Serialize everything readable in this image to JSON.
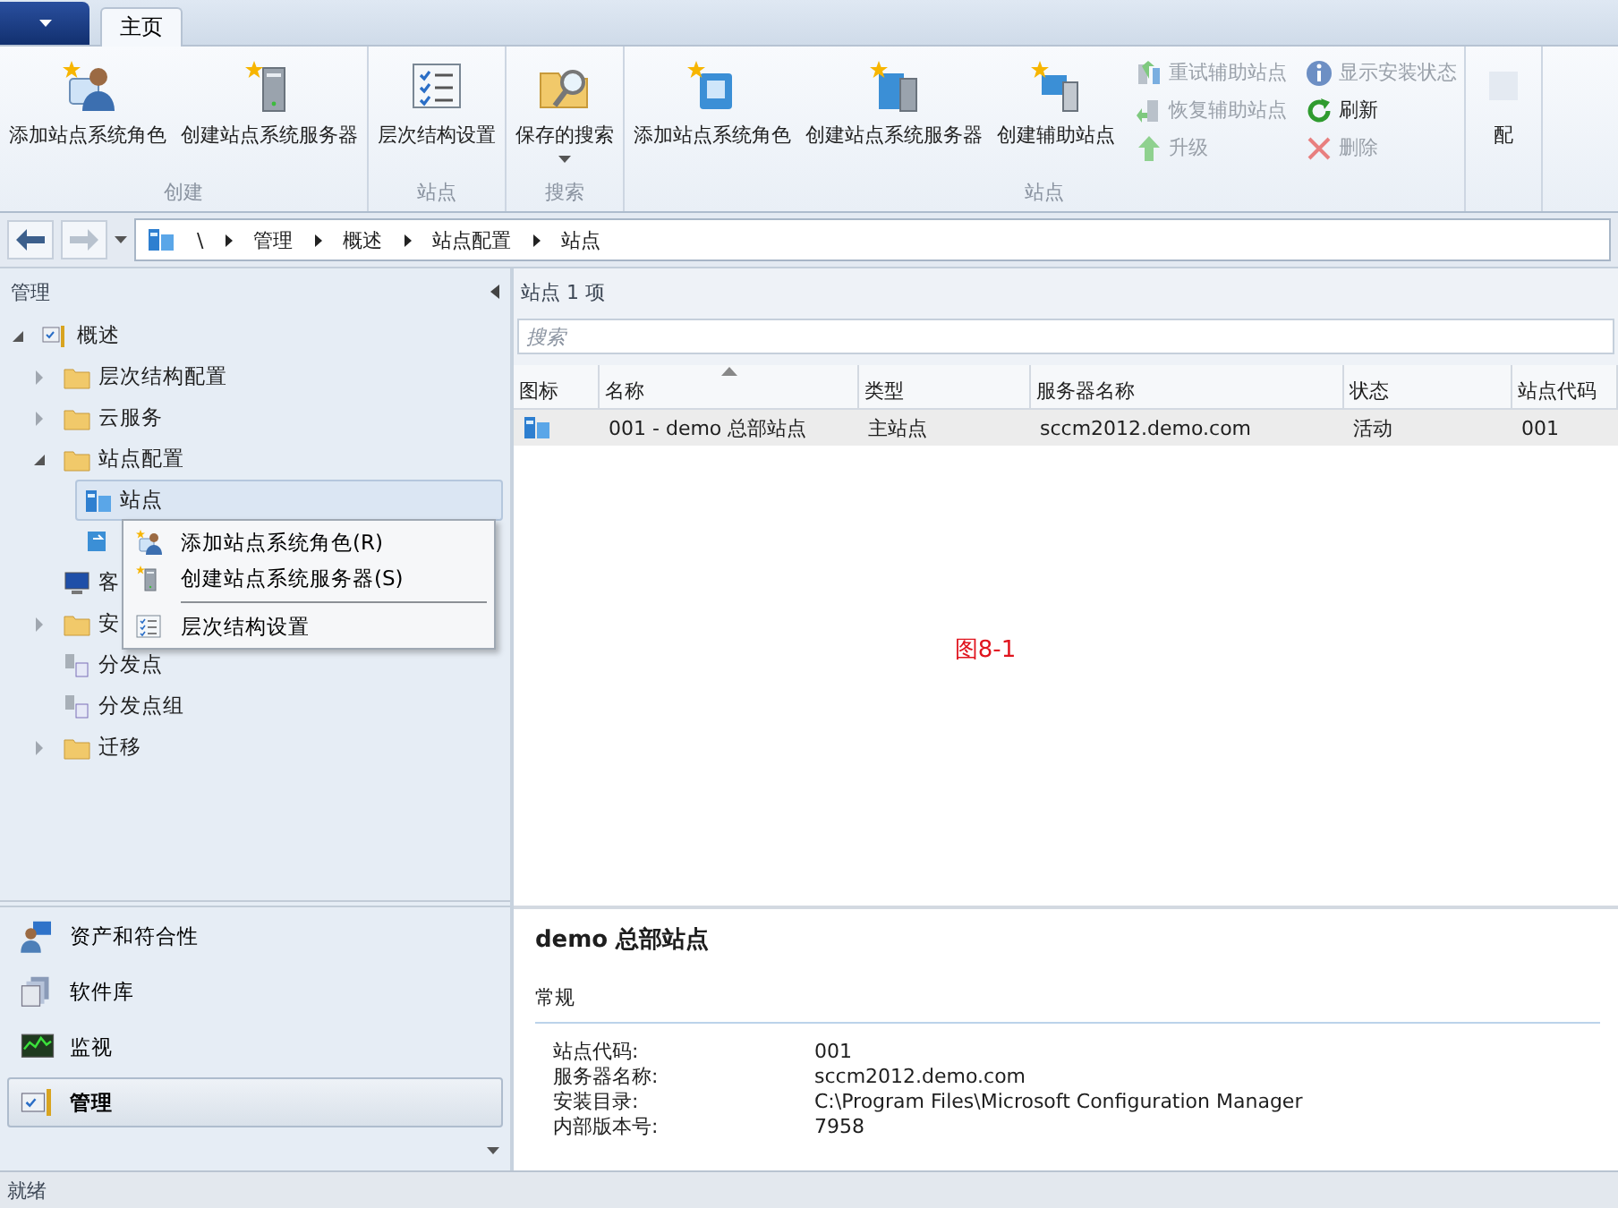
{
  "tabs": [
    {
      "label": "主页",
      "selected": true
    }
  ],
  "ribbon": {
    "groups": [
      {
        "label": "创建",
        "large": [
          {
            "label": "添加站点系统角色",
            "dropdown": false
          },
          {
            "label": "创建站点系统服务器",
            "dropdown": false
          }
        ]
      },
      {
        "label": "站点",
        "large": [
          {
            "label": "层次结构设置",
            "dropdown": false
          }
        ]
      },
      {
        "label": "搜索",
        "large": [
          {
            "label": "保存的搜索",
            "dropdown": true
          }
        ]
      },
      {
        "label": "站点",
        "large": [
          {
            "label": "添加站点系统角色",
            "dropdown": false
          },
          {
            "label": "创建站点系统服务器",
            "dropdown": false
          },
          {
            "label": "创建辅助站点",
            "dropdown": false
          }
        ],
        "small": [
          {
            "label": "重试辅助站点",
            "disabled": true
          },
          {
            "label": "恢复辅助站点",
            "disabled": true
          },
          {
            "label": "升级",
            "disabled": true
          },
          {
            "label": "显示安装状态",
            "disabled": true
          },
          {
            "label": "刷新",
            "disabled": false
          },
          {
            "label": "删除",
            "disabled": true
          }
        ]
      },
      {
        "large": [
          {
            "label": "配",
            "dropdown": false
          }
        ]
      }
    ]
  },
  "address_bar": {
    "path": [
      "\\",
      "管理",
      "概述",
      "站点配置",
      "站点"
    ]
  },
  "navigation": {
    "title": "管理",
    "tree": [
      {
        "label": "概述",
        "expanded": true,
        "selected": false,
        "children": [
          {
            "label": "层次结构配置",
            "expanded": false,
            "selected": false
          },
          {
            "label": "云服务",
            "expanded": false,
            "selected": false
          },
          {
            "label": "站点配置",
            "expanded": true,
            "selected": false,
            "children": [
              {
                "label": "站点",
                "selected": true
              },
              {
                "selected": false
              }
            ]
          },
          {
            "label": "客",
            "selected": false
          },
          {
            "label": "安",
            "expanded": false,
            "selected": false
          },
          {
            "label": "分发点",
            "selected": false
          },
          {
            "label": "分发点组",
            "selected": false
          },
          {
            "label": "迁移",
            "expanded": false,
            "selected": false
          }
        ]
      }
    ],
    "sections": [
      {
        "label": "资产和符合性",
        "selected": false
      },
      {
        "label": "软件库",
        "selected": false
      },
      {
        "label": "监视",
        "selected": false
      },
      {
        "label": "管理",
        "selected": true
      }
    ]
  },
  "context_menu": {
    "items": [
      {
        "kind": "command",
        "label": "添加站点系统角色(R)"
      },
      {
        "kind": "command",
        "label": "创建站点系统服务器(S)"
      },
      {
        "kind": "separator"
      },
      {
        "kind": "command",
        "label": "层次结构设置"
      }
    ]
  },
  "list": {
    "header": "站点 1 项",
    "search": {
      "placeholder": "搜索"
    },
    "columns": [
      {
        "label": "图标",
        "sorted": false
      },
      {
        "label": "名称",
        "sorted": true
      },
      {
        "label": "类型",
        "sorted": false
      },
      {
        "label": "服务器名称",
        "sorted": false
      },
      {
        "label": "状态",
        "sorted": false
      },
      {
        "label": "站点代码",
        "sorted": false
      }
    ],
    "rows": [
      {
        "selected": true,
        "cells": [
          "",
          "001 - demo 总部站点",
          "主站点",
          "sccm2012.demo.com",
          "活动",
          "001"
        ]
      }
    ]
  },
  "figure_caption": "图8-1",
  "details": {
    "title": "demo 总部站点",
    "section": "常规",
    "fields": [
      {
        "label": "站点代码:",
        "value": "001"
      },
      {
        "label": "服务器名称:",
        "value": "sccm2012.demo.com"
      },
      {
        "label": "安装目录:",
        "value": "C:\\Program Files\\Microsoft Configuration Manager"
      },
      {
        "label": "内部版本号:",
        "value": "7958"
      }
    ]
  },
  "status_bar": "就绪"
}
